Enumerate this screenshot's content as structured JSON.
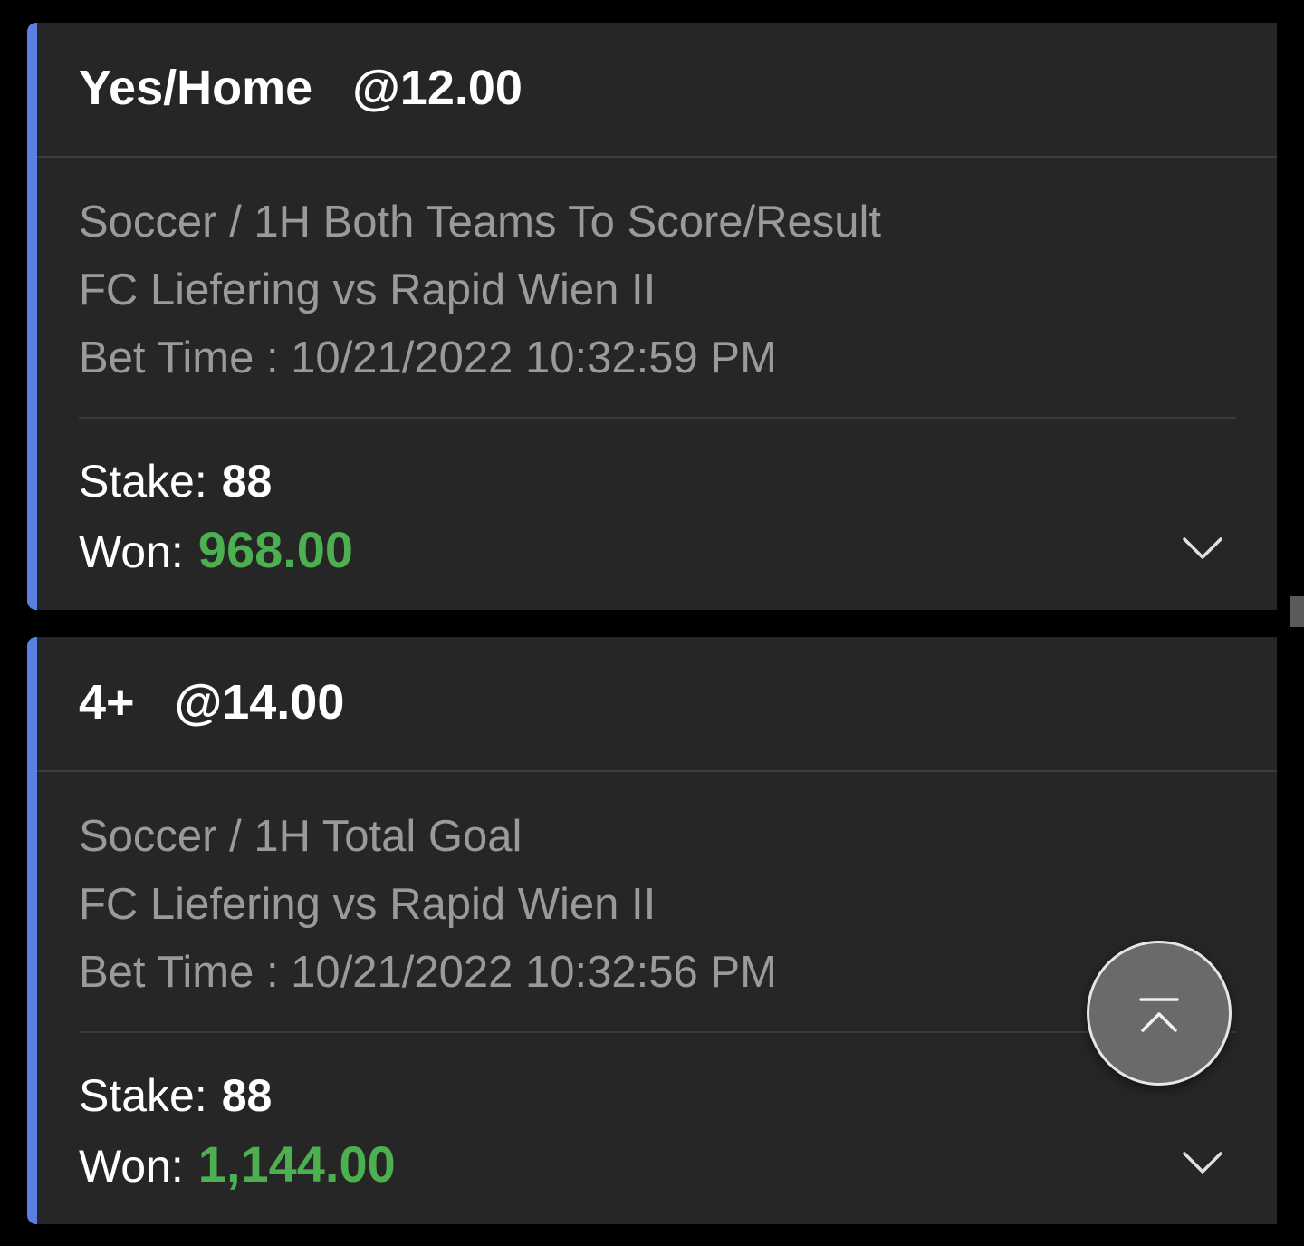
{
  "bets": [
    {
      "selection": "Yes/Home",
      "odds": "@12.00",
      "market": "Soccer / 1H Both Teams To Score/Result",
      "match": "FC Liefering vs Rapid Wien II",
      "bet_time": "Bet Time : 10/21/2022 10:32:59 PM",
      "stake_label": "Stake:",
      "stake": "88",
      "won_label": "Won:",
      "won": "968.00"
    },
    {
      "selection": "4+",
      "odds": "@14.00",
      "market": "Soccer / 1H Total Goal",
      "match": "FC Liefering vs Rapid Wien II",
      "bet_time": "Bet Time : 10/21/2022 10:32:56 PM",
      "stake_label": "Stake:",
      "stake": "88",
      "won_label": "Won:",
      "won": "1,144.00"
    }
  ],
  "icons": {
    "expand": "chevron-down-icon",
    "scroll_top": "arrow-up-to-top-icon"
  },
  "colors": {
    "background": "#000000",
    "card": "#262626",
    "accent": "#5b7fe3",
    "won": "#4caf50",
    "muted_text": "#9a9a9a"
  }
}
